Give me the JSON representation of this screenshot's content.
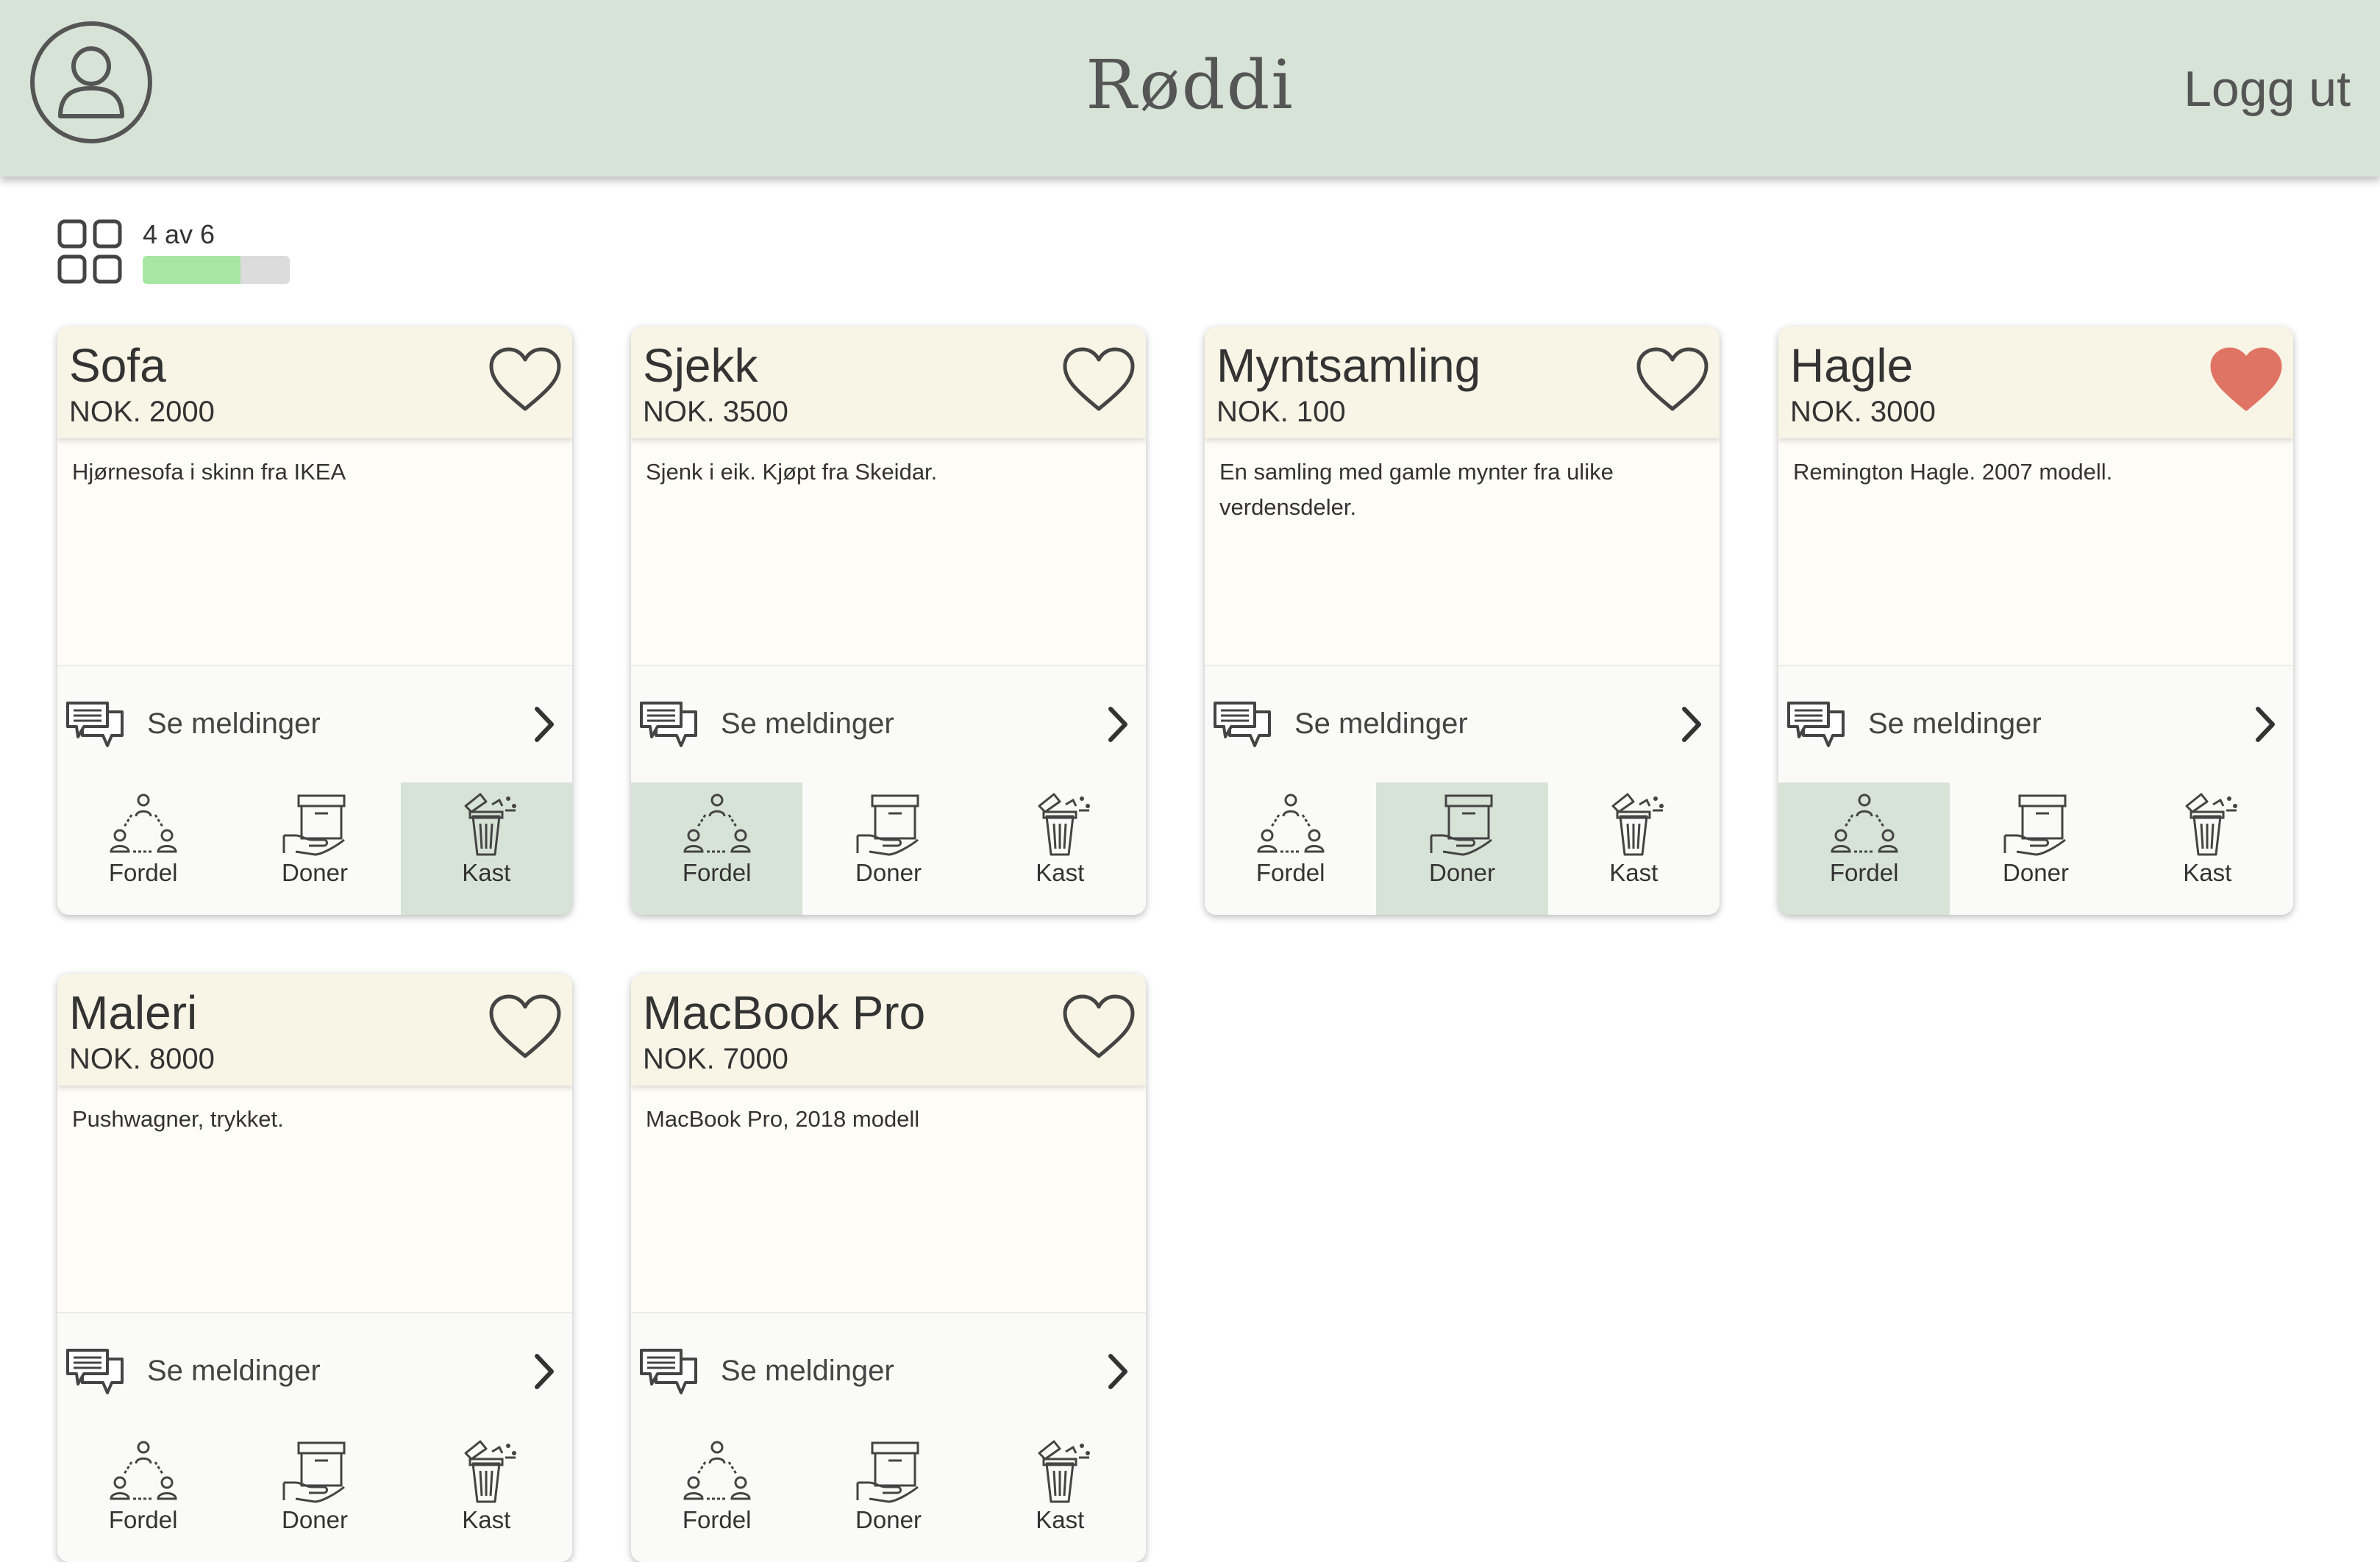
{
  "header": {
    "brand": "Røddi",
    "logout_label": "Logg ut"
  },
  "progress": {
    "label": "4 av 6",
    "fraction": 0.667
  },
  "colors": {
    "header_bg": "#d8e3d8",
    "card_head_bg": "#f8f5e6",
    "active_action_bg": "#d8e3d8",
    "heart_filled": "#e07464",
    "progress_fill": "#a8e6a4"
  },
  "card_labels": {
    "messages": "Se meldinger",
    "distribute": "Fordel",
    "donate": "Doner",
    "discard": "Kast"
  },
  "items": [
    {
      "title": "Sofa",
      "price": "NOK. 2000",
      "description": "Hjørnesofa i skinn fra IKEA",
      "favorite": false,
      "selected": "Kast"
    },
    {
      "title": "Sjekk",
      "price": "NOK. 3500",
      "description": "Sjenk i eik. Kjøpt fra Skeidar.",
      "favorite": false,
      "selected": "Fordel"
    },
    {
      "title": "Myntsamling",
      "price": "NOK. 100",
      "description": "En samling med gamle mynter fra ulike verdensdeler.",
      "favorite": false,
      "selected": "Doner"
    },
    {
      "title": "Hagle",
      "price": "NOK. 3000",
      "description": "Remington Hagle. 2007 modell.",
      "favorite": true,
      "selected": "Fordel"
    },
    {
      "title": "Maleri",
      "price": "NOK. 8000",
      "description": "Pushwagner, trykket.",
      "favorite": false,
      "selected": ""
    },
    {
      "title": "MacBook Pro",
      "price": "NOK. 7000",
      "description": "MacBook Pro, 2018 modell",
      "favorite": false,
      "selected": ""
    }
  ]
}
